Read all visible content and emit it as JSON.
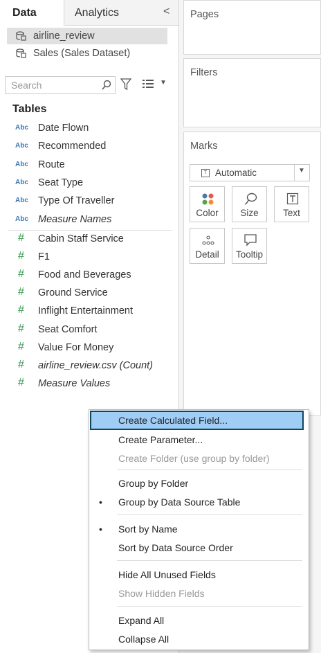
{
  "tabs": {
    "data": "Data",
    "analytics": "Analytics",
    "collapse": "<"
  },
  "datasources": [
    "airline_review",
    "Sales (Sales Dataset)"
  ],
  "search": {
    "placeholder": "Search"
  },
  "tables_label": "Tables",
  "dimensions": [
    {
      "type": "Abc",
      "label": "Date Flown"
    },
    {
      "type": "Abc",
      "label": "Recommended"
    },
    {
      "type": "Abc",
      "label": "Route"
    },
    {
      "type": "Abc",
      "label": "Seat Type"
    },
    {
      "type": "Abc",
      "label": "Type Of Traveller"
    },
    {
      "type": "Abc",
      "label": "Measure Names"
    }
  ],
  "measures": [
    {
      "type": "#",
      "label": "Cabin Staff Service"
    },
    {
      "type": "#",
      "label": "F1"
    },
    {
      "type": "#",
      "label": "Food and Beverages"
    },
    {
      "type": "#",
      "label": "Ground Service"
    },
    {
      "type": "#",
      "label": "Inflight Entertainment"
    },
    {
      "type": "#",
      "label": "Seat Comfort"
    },
    {
      "type": "#",
      "label": "Value For Money"
    },
    {
      "type": "#",
      "label": "airline_review.csv (Count)"
    },
    {
      "type": "#",
      "label": "Measure Values"
    }
  ],
  "shelves": {
    "pages": "Pages",
    "filters": "Filters",
    "marks": "Marks"
  },
  "marks": {
    "type": "Automatic",
    "type_icon": "T",
    "buttons": [
      {
        "label": "Color",
        "icon": "color-dots-icon"
      },
      {
        "label": "Size",
        "icon": "size-lasso-icon"
      },
      {
        "label": "Text",
        "icon": "text-T-icon"
      },
      {
        "label": "Detail",
        "icon": "detail-dots-icon"
      },
      {
        "label": "Tooltip",
        "icon": "tooltip-bubble-icon"
      }
    ]
  },
  "menu": {
    "create_calc": "Create Calculated Field...",
    "create_param": "Create Parameter...",
    "create_folder": "Create Folder (use group by folder)",
    "group_folder": "Group by Folder",
    "group_table": "Group by Data Source Table",
    "sort_name": "Sort by Name",
    "sort_order": "Sort by Data Source Order",
    "hide_unused": "Hide All Unused Fields",
    "show_hidden": "Show Hidden Fields",
    "expand": "Expand All",
    "collapse": "Collapse All",
    "bullet": "•"
  },
  "colors": {
    "highlight": "#9fcdf6",
    "highlight_border": "#0e4758",
    "dimension": "#3c78b4",
    "measure": "#3c9a53"
  }
}
